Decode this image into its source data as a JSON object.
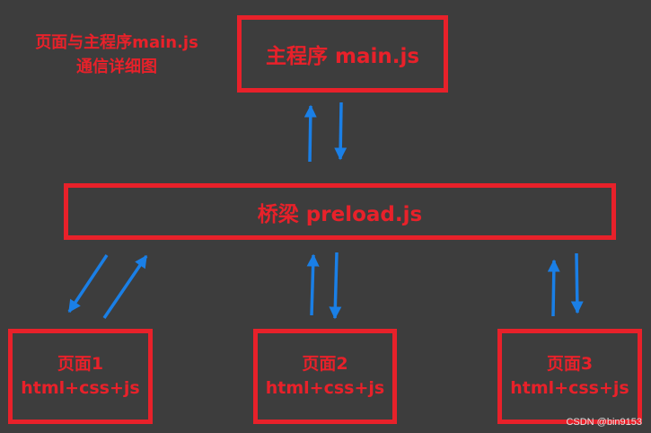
{
  "title": {
    "line1": "页面与主程序main.js",
    "line2": "通信详细图"
  },
  "boxes": {
    "main": {
      "label": "主程序 main.js"
    },
    "preload": {
      "label": "桥梁 preload.js"
    },
    "pages": [
      {
        "name": "页面1",
        "tech": "html+css+js"
      },
      {
        "name": "页面2",
        "tech": "html+css+js"
      },
      {
        "name": "页面3",
        "tech": "html+css+js"
      }
    ]
  },
  "watermark": "CSDN @bin9153",
  "colors": {
    "background": "#3d3d3d",
    "box_border": "#e8212a",
    "text": "#e8212a",
    "arrow": "#1a7fe6"
  }
}
